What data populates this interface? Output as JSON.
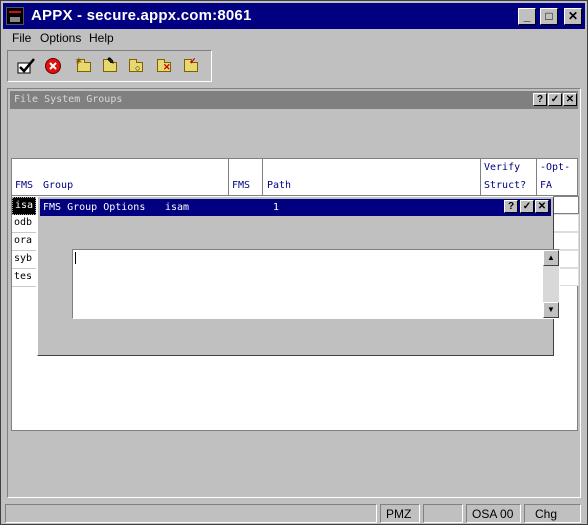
{
  "window": {
    "title": "APPX - secure.appx.com:8061",
    "controls": [
      "_",
      "□",
      "✕"
    ]
  },
  "menu": [
    "File",
    "Options",
    "Help"
  ],
  "toolbar": {
    "icons": [
      "ok-check-icon",
      "cancel-icon",
      "add-folder-icon",
      "change-folder-icon",
      "inquire-folder-icon",
      "delete-folder-icon",
      "special-folder-icon"
    ]
  },
  "document": {
    "title": "File System Groups",
    "buttons": [
      "?",
      "✓",
      "✕"
    ],
    "headers": {
      "fms": "FMS",
      "group": "Group",
      "fms2": "FMS",
      "path": "Path",
      "verify": "Verify",
      "struct": "Struct?",
      "opt": "-Opt-",
      "fa": "FA"
    },
    "rows": [
      "isa",
      "odb",
      "ora",
      "syb",
      "tes"
    ]
  },
  "dialog": {
    "title": "FMS Group Options",
    "group": "isam",
    "fms": "1",
    "buttons": [
      "?",
      "✓",
      "✕"
    ],
    "text_value": ""
  },
  "status": [
    "PMZ",
    "OSA 00",
    "Chg"
  ],
  "colors": {
    "titlebar": "#000080",
    "inactive_title": "#808080",
    "face": "#c0c0c0",
    "header_text": "#000080"
  }
}
